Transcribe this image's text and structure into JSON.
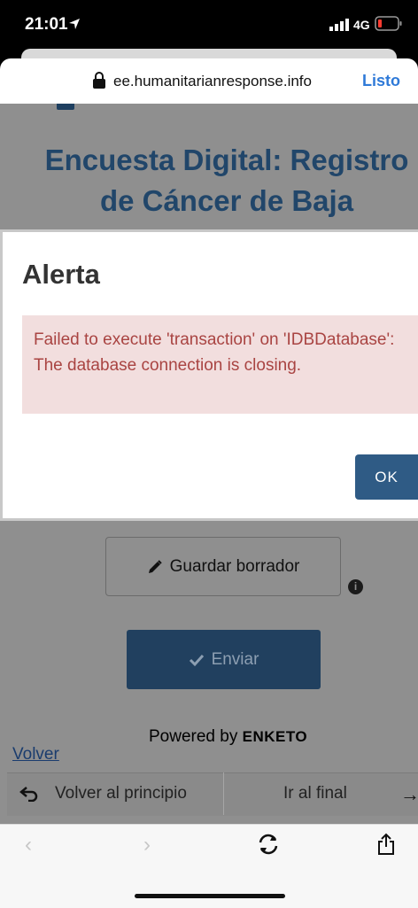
{
  "status_bar": {
    "time": "21:01",
    "network": "4G"
  },
  "browser": {
    "url": "ee.humanitarianresponse.info",
    "done_label": "Listo"
  },
  "form": {
    "title": "Encuesta Digital: Registro de Cáncer de Baja"
  },
  "modal": {
    "title": "Alerta",
    "message": "Failed to execute 'transaction' on 'IDBDatabase': The database connection is closing.",
    "ok_label": "OK"
  },
  "actions": {
    "save_draft_label": "Guardar borrador",
    "send_label": "Enviar",
    "powered_by": "Powered by",
    "brand": "ENKETO",
    "back_link": "Volver"
  },
  "nav": {
    "to_start": "Volver al principio",
    "to_end": "Ir al final"
  },
  "colors": {
    "primary": "#2f5b85",
    "title": "#21466a",
    "alert_bg": "#f2dede",
    "alert_text": "#a94442",
    "safari_blue": "#2f7ad8"
  }
}
